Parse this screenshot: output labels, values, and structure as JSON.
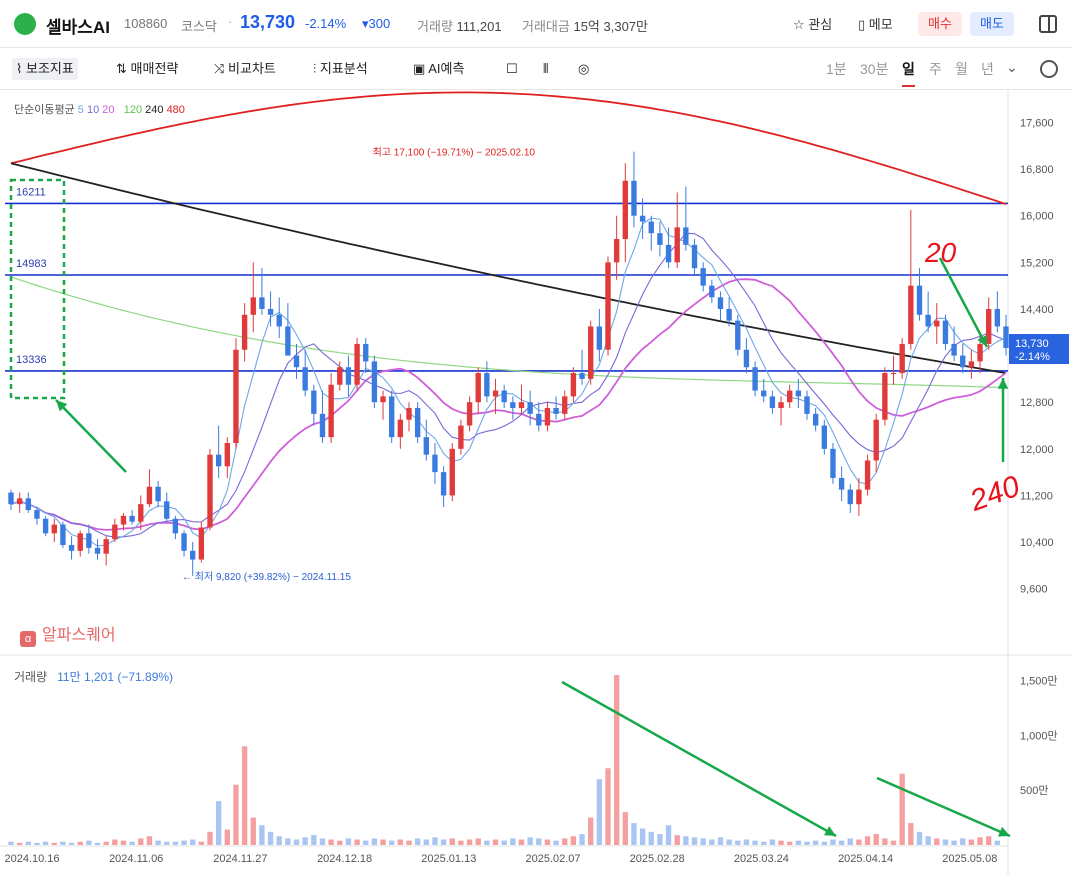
{
  "header": {
    "stock_name": "셀바스AI",
    "stock_code": "108860",
    "market": "코스닥",
    "separator": "·",
    "price": "13,730",
    "change_pct": "-2.14%",
    "change_abs": "▾300",
    "volume_label": "거래량",
    "volume_value": "111,201",
    "amount_label": "거래대금",
    "amount_value": "15억 3,307만",
    "watch_label": "관심",
    "memo_label": "메모",
    "buy_label": "매수",
    "sell_label": "매도"
  },
  "toolbar": {
    "indicators": "보조지표",
    "strategy": "매매전략",
    "compare": "비교차트",
    "analysis": "지표분석",
    "ai_predict": "AI예측",
    "periods": [
      "1분",
      "30분",
      "일",
      "주",
      "월",
      "년"
    ],
    "active_period": "일"
  },
  "legend": {
    "title": "단순이동평균",
    "ma5": "5",
    "ma10": "10",
    "ma20": "20",
    "ma120": "120",
    "ma240": "240",
    "ma480": "480",
    "ma_colors": {
      "ma5": "#6fa8e8",
      "ma10": "#7b68d8",
      "ma20": "#cf5fd9",
      "ma120": "#8fd883",
      "ma240": "#222222",
      "ma480": "#e02020"
    }
  },
  "brand": "알파스퀘어",
  "volume_legend": {
    "label": "거래량",
    "value": "11만 1,201 (−71.89%)"
  },
  "colors": {
    "up": "#e03a3a",
    "down": "#3a7be0",
    "up_vol": "#f4a0a0",
    "down_vol": "#a9c6f3",
    "hline": "#1432d0",
    "annot": "#18a84a",
    "handwrite": "#e8141c"
  },
  "chart_data": {
    "type": "candlestick",
    "x_ticks": [
      "2024.10.16",
      "2024.11.06",
      "2024.11.27",
      "2024.12.18",
      "2025.01.13",
      "2025.02.07",
      "2025.02.28",
      "2025.03.24",
      "2025.04.14",
      "2025.05.08"
    ],
    "y_ticks": [
      "17,600",
      "16,800",
      "16,000",
      "15,200",
      "14,400",
      "13,600",
      "12,800",
      "12,000",
      "11,200",
      "10,400",
      "9,600"
    ],
    "ylim": [
      9200,
      17900
    ],
    "volume_ticks": [
      "1,500만",
      "1,000만",
      "500만"
    ],
    "volume_ylim": [
      0,
      15500000
    ],
    "current_price": {
      "value": 13730,
      "label": "13,730",
      "change": "-2.14%"
    },
    "horizontal_lines": [
      {
        "value": 16211,
        "label": "16211"
      },
      {
        "value": 14983,
        "label": "14983"
      },
      {
        "value": 13336,
        "label": "13336"
      }
    ],
    "high_annotation": {
      "value": 17100,
      "label": "최고 17,100 (−19.71%) − 2025.02.10"
    },
    "low_annotation": {
      "value": 9820,
      "label": "최저 9,820 (+39.82%) − 2024.11.15"
    },
    "handwritten_labels": [
      "20",
      "240"
    ],
    "candles": [
      [
        11250,
        11300,
        10950,
        11050
      ],
      [
        11050,
        11250,
        10900,
        11150
      ],
      [
        11150,
        11250,
        10900,
        10950
      ],
      [
        10950,
        11000,
        10700,
        10800
      ],
      [
        10800,
        10850,
        10500,
        10550
      ],
      [
        10550,
        10800,
        10400,
        10700
      ],
      [
        10700,
        10750,
        10300,
        10350
      ],
      [
        10350,
        10500,
        10100,
        10250
      ],
      [
        10250,
        10600,
        10150,
        10550
      ],
      [
        10550,
        10700,
        10200,
        10300
      ],
      [
        10300,
        10450,
        10100,
        10200
      ],
      [
        10200,
        10500,
        10000,
        10450
      ],
      [
        10450,
        10800,
        10400,
        10700
      ],
      [
        10700,
        10900,
        10600,
        10850
      ],
      [
        10850,
        10950,
        10700,
        10750
      ],
      [
        10750,
        11200,
        10600,
        11050
      ],
      [
        11050,
        11650,
        11000,
        11350
      ],
      [
        11350,
        11450,
        11000,
        11100
      ],
      [
        11100,
        11250,
        10750,
        10800
      ],
      [
        10800,
        10850,
        10450,
        10550
      ],
      [
        10550,
        10600,
        10150,
        10250
      ],
      [
        10250,
        10400,
        9820,
        10100
      ],
      [
        10100,
        10750,
        10050,
        10650
      ],
      [
        10650,
        12000,
        10600,
        11900
      ],
      [
        11900,
        12400,
        11500,
        11700
      ],
      [
        11700,
        12200,
        11500,
        12100
      ],
      [
        12100,
        13900,
        12000,
        13700
      ],
      [
        13700,
        14500,
        13500,
        14300
      ],
      [
        14300,
        15200,
        14000,
        14600
      ],
      [
        14600,
        15100,
        14300,
        14400
      ],
      [
        14400,
        14700,
        14100,
        14300
      ],
      [
        14300,
        14600,
        13900,
        14100
      ],
      [
        14100,
        14500,
        13800,
        13600
      ],
      [
        13600,
        13800,
        13200,
        13400
      ],
      [
        13400,
        13700,
        12900,
        13000
      ],
      [
        13000,
        13100,
        12400,
        12600
      ],
      [
        12600,
        13000,
        12100,
        12200
      ],
      [
        12200,
        13300,
        12100,
        13100
      ],
      [
        13100,
        13500,
        13000,
        13400
      ],
      [
        13400,
        13600,
        12900,
        13100
      ],
      [
        13100,
        13900,
        13000,
        13800
      ],
      [
        13800,
        13900,
        13300,
        13500
      ],
      [
        13500,
        13600,
        12700,
        12800
      ],
      [
        12800,
        13000,
        12500,
        12900
      ],
      [
        12900,
        13000,
        12100,
        12200
      ],
      [
        12200,
        12600,
        12000,
        12500
      ],
      [
        12500,
        12800,
        12300,
        12700
      ],
      [
        12700,
        12800,
        12100,
        12200
      ],
      [
        12200,
        12500,
        11800,
        11900
      ],
      [
        11900,
        12100,
        11400,
        11600
      ],
      [
        11600,
        11700,
        11000,
        11200
      ],
      [
        11200,
        12100,
        11100,
        12000
      ],
      [
        12000,
        12500,
        11900,
        12400
      ],
      [
        12400,
        12900,
        12300,
        12800
      ],
      [
        12800,
        13400,
        12600,
        13300
      ],
      [
        13300,
        13500,
        12800,
        12900
      ],
      [
        12900,
        13200,
        12600,
        13000
      ],
      [
        13000,
        13100,
        12700,
        12800
      ],
      [
        12800,
        12900,
        12500,
        12700
      ],
      [
        12700,
        13100,
        12600,
        12800
      ],
      [
        12800,
        13000,
        12400,
        12600
      ],
      [
        12600,
        12800,
        12300,
        12400
      ],
      [
        12400,
        12800,
        12300,
        12700
      ],
      [
        12700,
        12900,
        12500,
        12600
      ],
      [
        12600,
        13000,
        12500,
        12900
      ],
      [
        12900,
        13400,
        12800,
        13300
      ],
      [
        13300,
        13700,
        13100,
        13200
      ],
      [
        13200,
        14200,
        13100,
        14100
      ],
      [
        14100,
        14400,
        13500,
        13700
      ],
      [
        13700,
        15300,
        13600,
        15200
      ],
      [
        15200,
        16000,
        14900,
        15600
      ],
      [
        15600,
        16900,
        15200,
        16600
      ],
      [
        16600,
        17100,
        15800,
        16000
      ],
      [
        16000,
        16300,
        15600,
        15900
      ],
      [
        15900,
        16000,
        15400,
        15700
      ],
      [
        15700,
        15900,
        15300,
        15500
      ],
      [
        15500,
        15800,
        15100,
        15200
      ],
      [
        15200,
        16400,
        15100,
        15800
      ],
      [
        15800,
        16500,
        15400,
        15500
      ],
      [
        15500,
        15600,
        15000,
        15100
      ],
      [
        15100,
        15200,
        14700,
        14800
      ],
      [
        14800,
        14900,
        14500,
        14600
      ],
      [
        14600,
        14700,
        14200,
        14400
      ],
      [
        14400,
        14600,
        14100,
        14200
      ],
      [
        14200,
        14300,
        13600,
        13700
      ],
      [
        13700,
        13900,
        13300,
        13400
      ],
      [
        13400,
        13500,
        12900,
        13000
      ],
      [
        13000,
        13200,
        12800,
        12900
      ],
      [
        12900,
        13000,
        12600,
        12700
      ],
      [
        12700,
        12900,
        12400,
        12800
      ],
      [
        12800,
        13100,
        12700,
        13000
      ],
      [
        13000,
        13200,
        12700,
        12900
      ],
      [
        12900,
        13000,
        12500,
        12600
      ],
      [
        12600,
        12700,
        12300,
        12400
      ],
      [
        12400,
        12500,
        11900,
        12000
      ],
      [
        12000,
        12100,
        11400,
        11500
      ],
      [
        11500,
        11700,
        11100,
        11300
      ],
      [
        11300,
        11400,
        10900,
        11050
      ],
      [
        11050,
        11500,
        10850,
        11300
      ],
      [
        11300,
        11900,
        11200,
        11800
      ],
      [
        11800,
        12600,
        11600,
        12500
      ],
      [
        12500,
        13400,
        12400,
        13300
      ],
      [
        13300,
        13600,
        13100,
        13300
      ],
      [
        13300,
        13900,
        13200,
        13800
      ],
      [
        13800,
        16100,
        13700,
        14800
      ],
      [
        14800,
        15100,
        14200,
        14300
      ],
      [
        14300,
        14700,
        14000,
        14100
      ],
      [
        14100,
        14500,
        13800,
        14200
      ],
      [
        14200,
        14300,
        13700,
        13800
      ],
      [
        13800,
        14100,
        13500,
        13600
      ],
      [
        13600,
        13800,
        13300,
        13400
      ],
      [
        13400,
        13700,
        13200,
        13500
      ],
      [
        13500,
        14000,
        13300,
        13800
      ],
      [
        13800,
        14600,
        13700,
        14400
      ],
      [
        14400,
        14700,
        14000,
        14100
      ],
      [
        14100,
        14300,
        13600,
        13730
      ]
    ],
    "volumes": [
      3,
      2,
      3,
      2,
      3,
      2,
      3,
      2,
      3,
      4,
      2,
      3,
      5,
      4,
      3,
      6,
      8,
      4,
      3,
      3,
      4,
      5,
      3,
      12,
      40,
      14,
      55,
      90,
      25,
      18,
      12,
      8,
      6,
      5,
      7,
      9,
      6,
      5,
      4,
      6,
      5,
      4,
      6,
      5,
      4,
      5,
      4,
      6,
      5,
      7,
      5,
      6,
      4,
      5,
      6,
      4,
      5,
      4,
      6,
      5,
      7,
      6,
      5,
      4,
      6,
      8,
      10,
      25,
      60,
      70,
      155,
      30,
      20,
      15,
      12,
      10,
      18,
      9,
      8,
      7,
      6,
      5,
      7,
      5,
      4,
      5,
      4,
      3,
      5,
      4,
      3,
      4,
      3,
      4,
      3,
      5,
      4,
      6,
      5,
      8,
      10,
      6,
      4,
      65,
      20,
      12,
      8,
      6,
      5,
      4,
      6,
      5,
      7,
      8,
      4
    ]
  }
}
